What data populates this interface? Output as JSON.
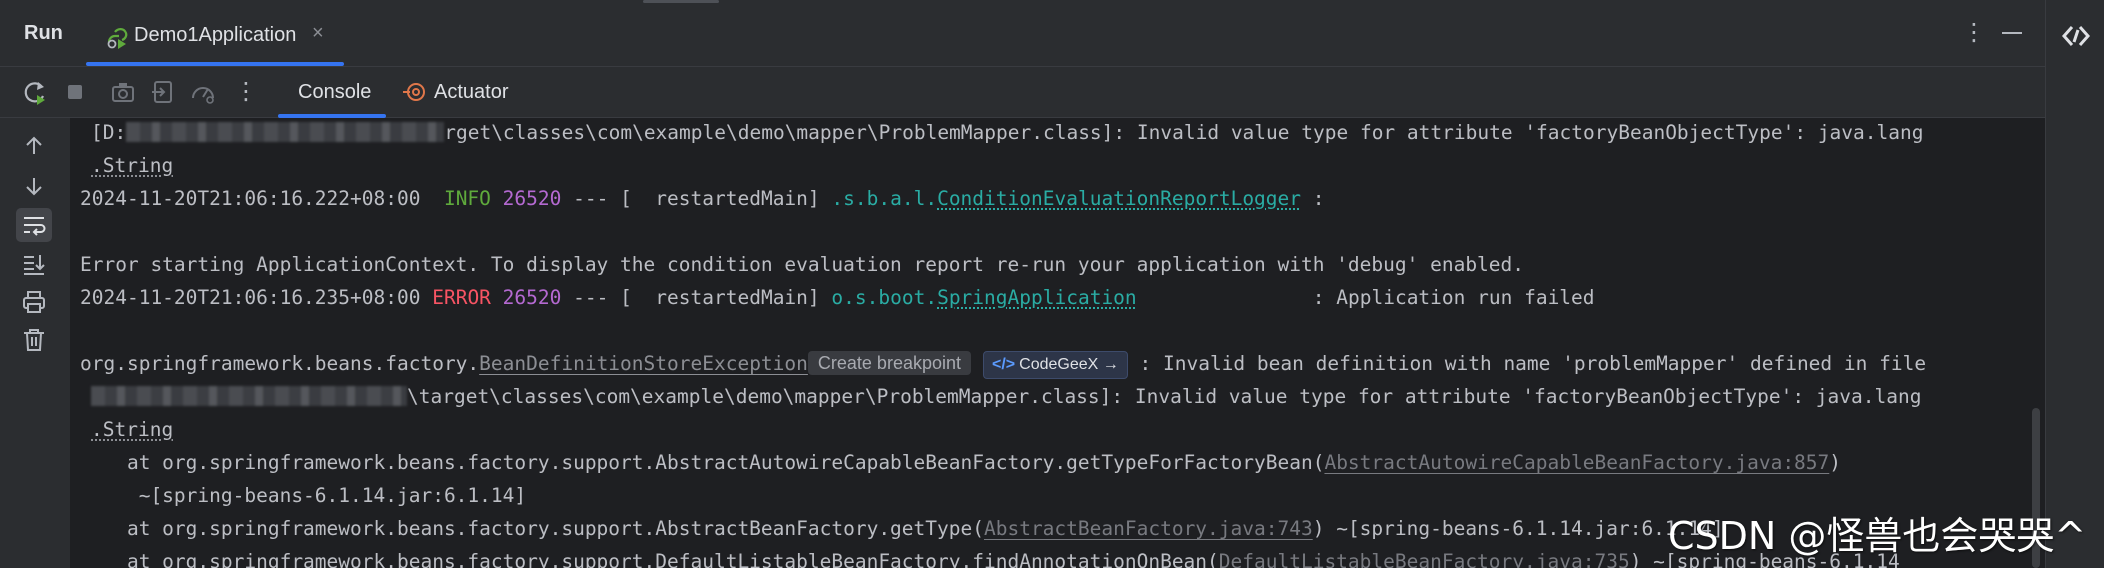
{
  "header": {
    "run_label": "Run",
    "tab_label": "Demo1Application",
    "tab_close": "×",
    "more": "⋮"
  },
  "toolbar": {
    "more": "⋮",
    "tabs": [
      {
        "label": "Console"
      },
      {
        "label": "Actuator"
      }
    ]
  },
  "console": {
    "line1": {
      "prefix": "[D:",
      "suffix": "rget\\classes\\com\\example\\demo\\mapper\\ProblemMapper.class]: Invalid value type for attribute 'factoryBeanObjectType': java.lang"
    },
    "line2": ".String",
    "line3": {
      "timestamp": "2024-11-20T21:06:16.222+08:00",
      "level": "INFO",
      "pid": "26520",
      "sep": " --- [  restartedMain] ",
      "logger_pkg": ".s.b.a.l.",
      "logger_cls": "ConditionEvaluationReportLogger",
      "msg": " :"
    },
    "line5": "Error starting ApplicationContext. To display the condition evaluation report re-run your application with 'debug' enabled.",
    "line6": {
      "timestamp": "2024-11-20T21:06:16.235+08:00",
      "level": "ERROR",
      "pid": "26520",
      "sep": " --- [  restartedMain] ",
      "logger_pkg": "o.s.boot.",
      "logger_cls": "SpringApplication",
      "msg": "               : Application run failed"
    },
    "line8": {
      "prefix": "org.springframework.beans.factory.",
      "exception": "BeanDefinitionStoreException",
      "chip_breakpoint": "Create breakpoint",
      "chip_codegeex": "CodeGeeX",
      "chip_arrow": "→",
      "msg": " : Invalid bean definition with name 'problemMapper' defined in file"
    },
    "line9": {
      "suffix": "\\target\\classes\\com\\example\\demo\\mapper\\ProblemMapper.class]: Invalid value type for attribute 'factoryBeanObjectType': java.lang"
    },
    "line10": ".String",
    "line11": {
      "prefix": "    at org.springframework.beans.factory.support.AbstractAutowireCapableBeanFactory.getTypeForFactoryBean(",
      "link": "AbstractAutowireCapableBeanFactory.java:857",
      "suffix": ")"
    },
    "line12": "     ~[spring-beans-6.1.14.jar:6.1.14]",
    "line13": {
      "prefix": "    at org.springframework.beans.factory.support.AbstractBeanFactory.getType(",
      "link": "AbstractBeanFactory.java:743",
      "suffix": ") ~[spring-beans-6.1.14.jar:6.1.14]"
    },
    "line14": {
      "prefix": "    at org.springframework.beans.factory.support.DefaultListableBeanFactory.findAnnotationOnBean(",
      "link": "DefaultListableBeanFactory.java:735",
      "suffix": ") ~[spring-beans-6.1.14"
    }
  },
  "watermark": "CSDN @怪兽也会哭哭^",
  "colors": {
    "background": "#1e1f22",
    "panel": "#2b2d30",
    "accent": "#3574f0",
    "info": "#5faa3c",
    "error": "#f75464",
    "pid": "#b469d1",
    "logger": "#2aaca4"
  },
  "icons": {
    "tab": "run-app-icon",
    "rerun": "rerun-icon",
    "stop": "stop-icon",
    "screenshot": "camera-icon",
    "exit": "exit-icon",
    "profiler": "gauge-icon",
    "actuator": "actuator-icon",
    "up": "arrow-up-icon",
    "down": "arrow-down-icon",
    "wrap": "soft-wrap-icon",
    "scroll_end": "scroll-to-end-icon",
    "print": "print-icon",
    "clear": "trash-icon",
    "codegeex": "codegeex-icon"
  }
}
